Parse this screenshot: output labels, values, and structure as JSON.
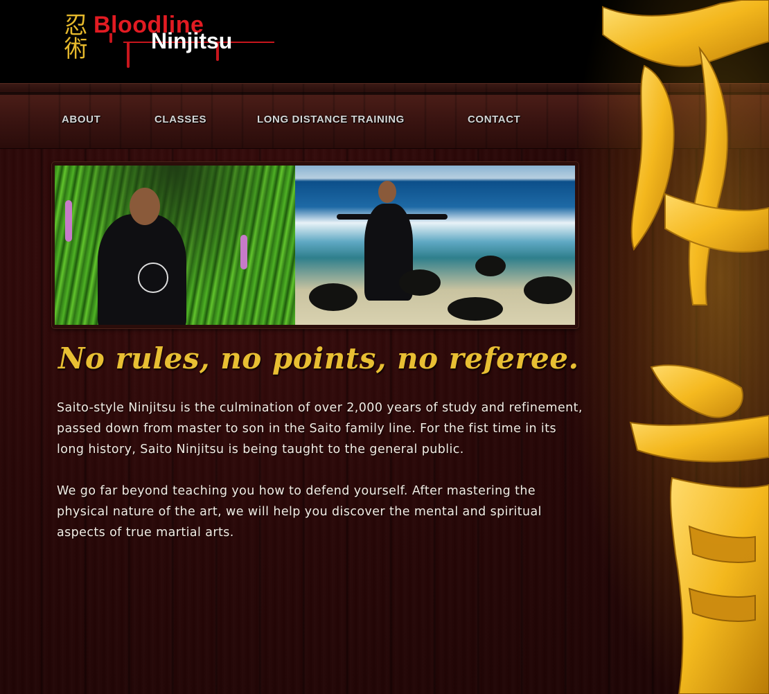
{
  "logo": {
    "kanji": "忍術",
    "brand_line1": "Bloodline",
    "brand_line2": "Ninjitsu"
  },
  "nav": {
    "items": [
      {
        "label": "ABOUT"
      },
      {
        "label": "CLASSES"
      },
      {
        "label": "LONG DISTANCE TRAINING"
      },
      {
        "label": "CONTACT"
      }
    ]
  },
  "main": {
    "headline": "No rules, no points, no referee.",
    "paragraphs": [
      "Saito-style Ninjitsu is the culmination of over 2,000 years of study and refinement, passed down from master to son in the Saito family line. For the fist time in its long history, Saito Ninjitsu is being taught to the general public.",
      "We go far beyond teaching you how to defend yourself. After mastering the physical nature of the art, we will help you discover the mental and spiritual aspects of true martial arts."
    ]
  },
  "colors": {
    "brand_red": "#e21b22",
    "gold": "#e8bf33",
    "nav_text": "#d6d6d6",
    "body_text": "#f2ece4"
  },
  "icons": {
    "decorative_art": "golden-kanji-artwork",
    "banner_left": "master-in-garden-photo",
    "banner_right": "master-on-beach-photo"
  }
}
